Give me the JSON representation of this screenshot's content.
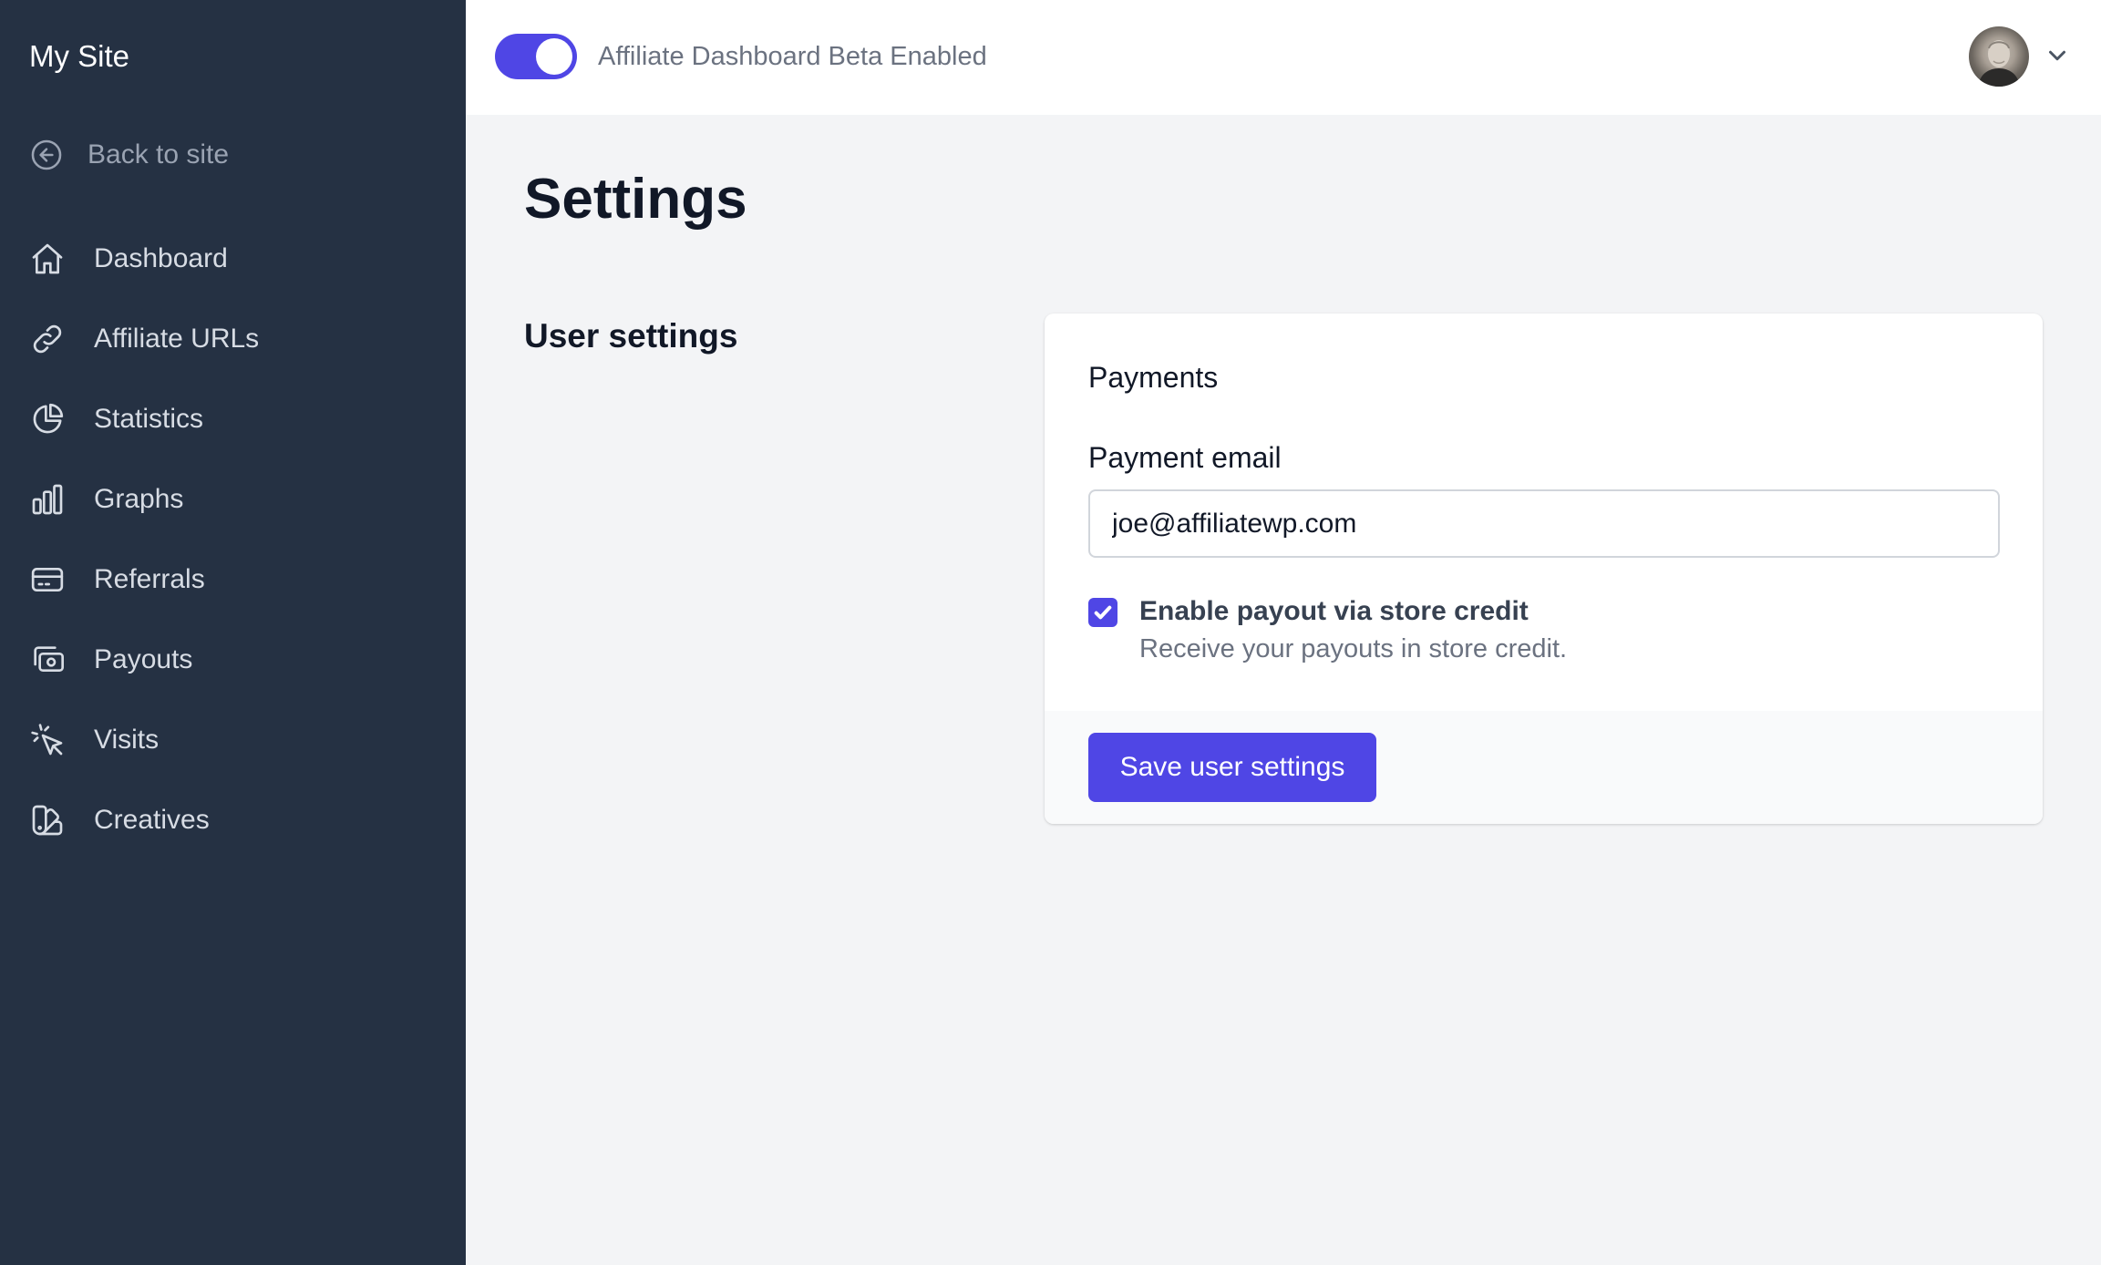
{
  "sidebar": {
    "site_title": "My Site",
    "back_link": {
      "label": "Back to site",
      "icon": "arrow-left-circle-icon"
    },
    "items": [
      {
        "label": "Dashboard",
        "icon": "home-icon"
      },
      {
        "label": "Affiliate URLs",
        "icon": "link-icon"
      },
      {
        "label": "Statistics",
        "icon": "pie-chart-icon"
      },
      {
        "label": "Graphs",
        "icon": "bar-chart-icon"
      },
      {
        "label": "Referrals",
        "icon": "credit-card-icon"
      },
      {
        "label": "Payouts",
        "icon": "cash-icon"
      },
      {
        "label": "Visits",
        "icon": "cursor-click-icon"
      },
      {
        "label": "Creatives",
        "icon": "color-swatch-icon"
      }
    ]
  },
  "header": {
    "beta_toggle": {
      "label": "Affiliate Dashboard Beta Enabled",
      "enabled": true
    },
    "user_menu": {
      "avatar_icon": "user-avatar",
      "chevron_icon": "chevron-down-icon"
    }
  },
  "main": {
    "page_title": "Settings",
    "section_title": "User settings",
    "payments": {
      "heading": "Payments",
      "email_label": "Payment email",
      "email_value": "joe@affiliatewp.com",
      "store_credit": {
        "label": "Enable payout via store credit",
        "help": "Receive your payouts in store credit.",
        "checked": true
      },
      "save_label": "Save user settings"
    }
  },
  "colors": {
    "sidebar_bg": "#253143",
    "accent": "#4f46e5",
    "page_bg": "#f3f4f6"
  }
}
